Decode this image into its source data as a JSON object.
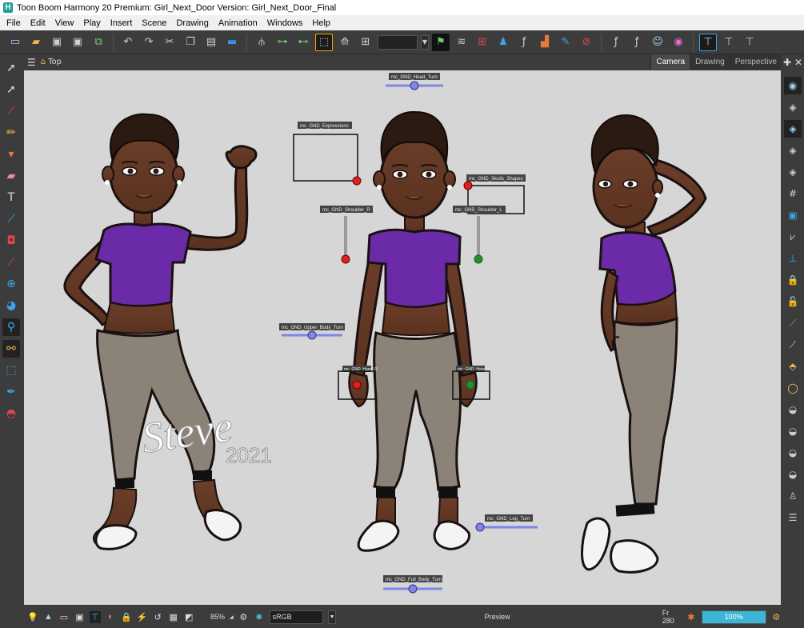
{
  "window": {
    "logo_letter": "H",
    "title": "Toon Boom Harmony 20 Premium: Girl_Next_Door Version: Girl_Next_Door_Final"
  },
  "menu": [
    "File",
    "Edit",
    "View",
    "Play",
    "Insert",
    "Scene",
    "Drawing",
    "Animation",
    "Windows",
    "Help"
  ],
  "view": {
    "breadcrumb": "Top",
    "tabs": [
      "Camera",
      "Drawing",
      "Perspective"
    ],
    "active_tab": "Camera"
  },
  "rig_controls": {
    "head_turn": "mc_GND_Head_Turn",
    "expressions": "mc_GND_Expressions",
    "skull_shapes": "mc_GND_Skulls_Shapes",
    "shoulder_r": "mc_GND_Shoulder_R",
    "shoulder_l": "mc_GND_Shoulder_L",
    "upper_body_turn": "mc_GND_Upper_Body_Turn",
    "hand_r": "mc_GND_Hand_R",
    "hand_l": "mc_GND_Hand_L",
    "leg_turn": "mc_GND_Leg_Turn",
    "full_body_turn": "mc_GND_Full_Body_Turn"
  },
  "watermark": {
    "name": "Steve",
    "year": "2021"
  },
  "status": {
    "zoom": "85%",
    "color_space": "sRGB",
    "mode": "Preview",
    "frame": "Fr 280",
    "render_progress_label": "100%",
    "render_progress": 1.0
  },
  "colors": {
    "shirt": "#6b2aa8",
    "pants": "#8b8278",
    "skin": "#6a3e2a",
    "hair": "#2b1a12",
    "control_red": "#e02020",
    "control_green": "#2e8b2e",
    "slider": "#7f86e6",
    "accent": "#3cb6d6"
  }
}
